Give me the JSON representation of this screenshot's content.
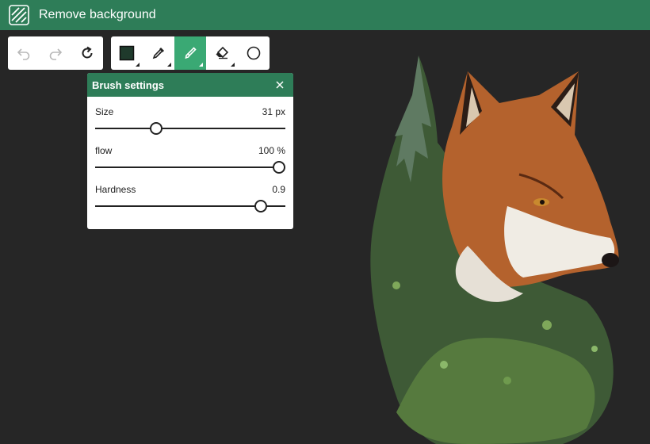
{
  "app": {
    "title": "Remove background"
  },
  "toolbar": {
    "history": [
      {
        "name": "undo-button",
        "icon": "undo-icon",
        "enabled": false
      },
      {
        "name": "redo-button",
        "icon": "redo-icon",
        "enabled": false
      },
      {
        "name": "reset-button",
        "icon": "reset-icon",
        "enabled": true
      }
    ],
    "tools": [
      {
        "name": "color-swatch-button",
        "icon": "color-swatch-icon",
        "color": "#1f3a2c"
      },
      {
        "name": "eyedropper-button",
        "icon": "eyedropper-icon"
      },
      {
        "name": "brush-button",
        "icon": "brush-icon",
        "active": true
      },
      {
        "name": "eraser-button",
        "icon": "eraser-icon"
      },
      {
        "name": "shape-button",
        "icon": "circle-icon"
      }
    ]
  },
  "brush_settings": {
    "title": "Brush settings",
    "size": {
      "label": "Size",
      "value": "31 px",
      "level": 0.32
    },
    "flow": {
      "label": "flow",
      "value": "100 %",
      "level": 1.0
    },
    "hardness": {
      "label": "Hardness",
      "value": "0.9",
      "level": 0.87
    }
  },
  "colors": {
    "accent": "#2e7d58",
    "active_tool": "#3aa974",
    "canvas_bg": "#262626"
  }
}
